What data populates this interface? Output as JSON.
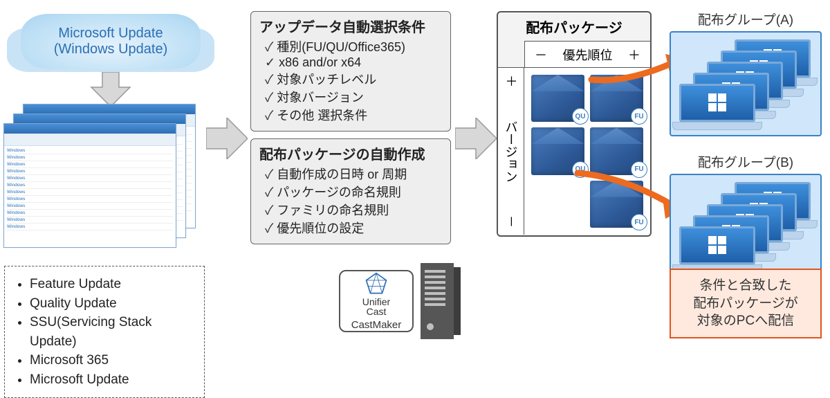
{
  "cloud": {
    "line1": "Microsoft Update",
    "line2": "(Windows Update)"
  },
  "update_types": [
    "Feature Update",
    "Quality Update",
    "SSU(Servicing Stack Update)",
    "Microsoft 365",
    "Microsoft Update"
  ],
  "criteria": {
    "title": "アップデータ自動選択条件",
    "items": [
      "種別(FU/QU/Office365)",
      "x86 and/or x64",
      "対象パッチレベル",
      "対象バージョン",
      "その他 選択条件"
    ]
  },
  "autobuild": {
    "title": "配布パッケージの自動作成",
    "items": [
      "自動作成の日時 or 周期",
      "パッケージの命名規則",
      "ファミリの命名規則",
      "優先順位の設定"
    ]
  },
  "castmaker": {
    "brand_top": "Unifier",
    "brand_bottom": "Cast",
    "sub": "CastMaker"
  },
  "package_panel": {
    "title": "配布パッケージ",
    "x_axis": "優先順位",
    "y_axis": "バージョン",
    "x_minus": "－",
    "x_plus": "＋",
    "y_plus": "＋",
    "y_minus": "－",
    "tags": [
      "QU",
      "FU",
      "QU",
      "FU",
      "",
      "FU"
    ]
  },
  "groups": {
    "a": "配布グループ(A)",
    "b": "配布グループ(B)"
  },
  "caption": {
    "l1": "条件と合致した",
    "l2": "配布パッケージが",
    "l3": "対象のPCへ配信"
  }
}
